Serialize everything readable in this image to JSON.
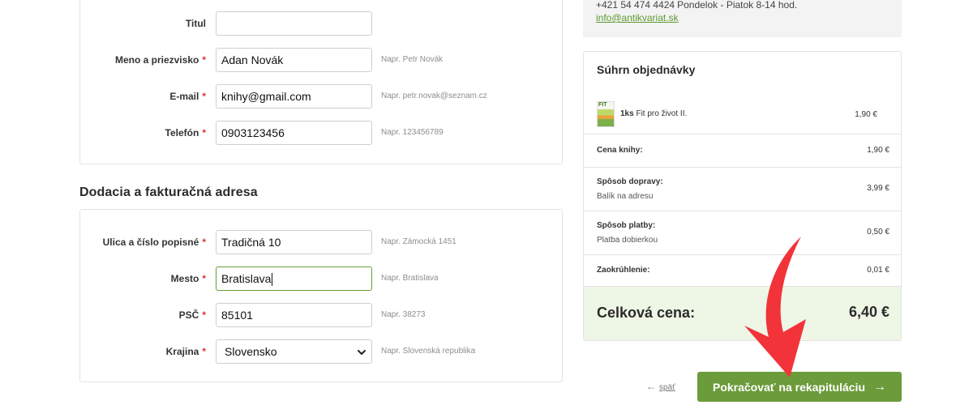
{
  "personal": {
    "rows": [
      {
        "label": "Titul",
        "required": "",
        "value": "",
        "hint": ""
      },
      {
        "label": "Meno a priezvisko",
        "required": "*",
        "value": "Adan Novák",
        "hint": "Napr. Petr Novák"
      },
      {
        "label": "E-mail",
        "required": "*",
        "value": "knihy@gmail.com",
        "hint": "Napr. petr.novak@seznam.cz"
      },
      {
        "label": "Telefón",
        "required": "*",
        "value": "0903123456",
        "hint": "Napr. 123456789"
      }
    ]
  },
  "address": {
    "title": "Dodacia a fakturačná adresa",
    "rows": [
      {
        "label": "Ulica a číslo popisné",
        "required": "*",
        "value": "Tradičná 10",
        "hint": "Napr. Zámocká 1451"
      },
      {
        "label": "Mesto",
        "required": "*",
        "value": "Bratislava",
        "hint": "Napr. Bratislava"
      },
      {
        "label": "PSČ",
        "required": "*",
        "value": "85101",
        "hint": "Napr. 38273"
      },
      {
        "label": "Krajina",
        "required": "*",
        "value": "Slovensko",
        "hint": "Napr. Slovenská republika"
      }
    ]
  },
  "contact": {
    "phone": "+421 54 474 4424",
    "hours": "Pondelok - Piatok 8-14 hod.",
    "email": "info@antikvariat.sk"
  },
  "summary": {
    "title": "Súhrn objednávky",
    "item": {
      "qty": "1ks",
      "name": "Fit pro život II.",
      "price": "1,90 €",
      "thumb_text": "FIT"
    },
    "rows": [
      {
        "key": "Cena knihy:",
        "sub": "",
        "value": "1,90 €"
      },
      {
        "key": "Spôsob dopravy:",
        "sub": "Balík na adresu",
        "value": "3,99 €"
      },
      {
        "key": "Spôsob platby:",
        "sub": "Platba dobierkou",
        "value": "0,50 €"
      },
      {
        "key": "Zaokrúhlenie:",
        "sub": "",
        "value": "0,01 €"
      }
    ],
    "total_label": "Celková cena:",
    "total_value": "6,40 €"
  },
  "actions": {
    "back_label": "späť",
    "continue_label": "Pokračovať na rekapituláciu"
  },
  "colors": {
    "accent": "#6b9b3a",
    "required": "#e03131",
    "arrow": "#f2333a",
    "total_bg": "#eef6e6"
  }
}
